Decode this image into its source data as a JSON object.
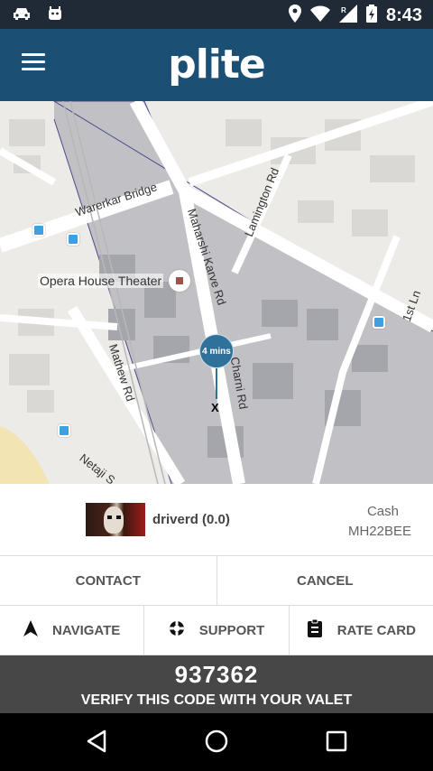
{
  "status_bar": {
    "time": "8:43"
  },
  "app": {
    "logo": "plite"
  },
  "map": {
    "streets": [
      "Warerkar Bridge",
      "Maharshi Karve Rd",
      "Lamington Rd",
      "Mathew Rd",
      "Charni Rd",
      "1st Ln",
      "Netaji S"
    ],
    "poi": "Opera House Theater",
    "eta": "4 mins",
    "marker": "X"
  },
  "driver": {
    "name": "driverd (0.0)",
    "payment": "Cash",
    "plate": "MH22BEE"
  },
  "actions": {
    "contact": "CONTACT",
    "cancel": "CANCEL",
    "navigate": "NAVIGATE",
    "support": "SUPPORT",
    "rate_card": "RATE CARD"
  },
  "verify": {
    "code": "937362",
    "message": "VERIFY THIS CODE WITH YOUR VALET"
  },
  "colors": {
    "appbar": "#1b4f73",
    "statusbar": "#1f2a36",
    "pin": "#2f7198",
    "codebar": "#474747"
  }
}
